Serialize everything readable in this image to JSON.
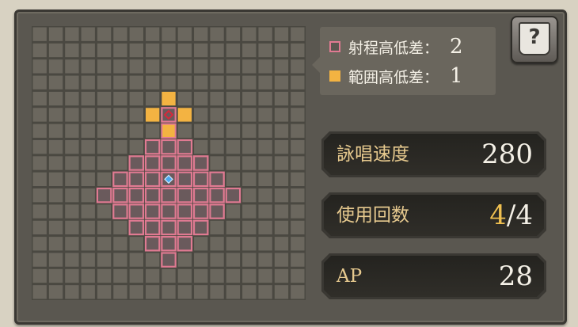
{
  "legend": {
    "range_height_label": "射程高低差：",
    "range_height_value": "2",
    "area_height_label": "範囲高低差：",
    "area_height_value": "1"
  },
  "help": {
    "glyph": "?"
  },
  "stats": {
    "cast_speed": {
      "label": "詠唱速度",
      "value": "280"
    },
    "uses": {
      "label": "使用回数",
      "current": "4",
      "separator": "/",
      "max": "4"
    },
    "ap": {
      "label": "AP",
      "value": "28"
    }
  },
  "range_grid": {
    "columns": 17,
    "rows": 17,
    "caster": [
      8,
      9
    ],
    "target": [
      8,
      5
    ],
    "range_cells": [
      [
        8,
        5
      ],
      [
        8,
        6
      ],
      [
        7,
        7
      ],
      [
        8,
        7
      ],
      [
        9,
        7
      ],
      [
        6,
        8
      ],
      [
        7,
        8
      ],
      [
        8,
        8
      ],
      [
        9,
        8
      ],
      [
        10,
        8
      ],
      [
        5,
        9
      ],
      [
        6,
        9
      ],
      [
        7,
        9
      ],
      [
        8,
        9
      ],
      [
        9,
        9
      ],
      [
        10,
        9
      ],
      [
        11,
        9
      ],
      [
        4,
        10
      ],
      [
        5,
        10
      ],
      [
        6,
        10
      ],
      [
        7,
        10
      ],
      [
        8,
        10
      ],
      [
        9,
        10
      ],
      [
        10,
        10
      ],
      [
        11,
        10
      ],
      [
        12,
        10
      ],
      [
        5,
        11
      ],
      [
        6,
        11
      ],
      [
        7,
        11
      ],
      [
        8,
        11
      ],
      [
        9,
        11
      ],
      [
        10,
        11
      ],
      [
        11,
        11
      ],
      [
        6,
        12
      ],
      [
        7,
        12
      ],
      [
        8,
        12
      ],
      [
        9,
        12
      ],
      [
        10,
        12
      ],
      [
        7,
        13
      ],
      [
        8,
        13
      ],
      [
        9,
        13
      ],
      [
        8,
        14
      ]
    ],
    "area_cells": [
      [
        8,
        4
      ],
      [
        7,
        5
      ],
      [
        9,
        5
      ],
      [
        8,
        6
      ]
    ],
    "colors": {
      "empty": "#6b675e",
      "range": "#e07a92",
      "area": "#f3b342",
      "caster": "#4aa8f0"
    }
  }
}
